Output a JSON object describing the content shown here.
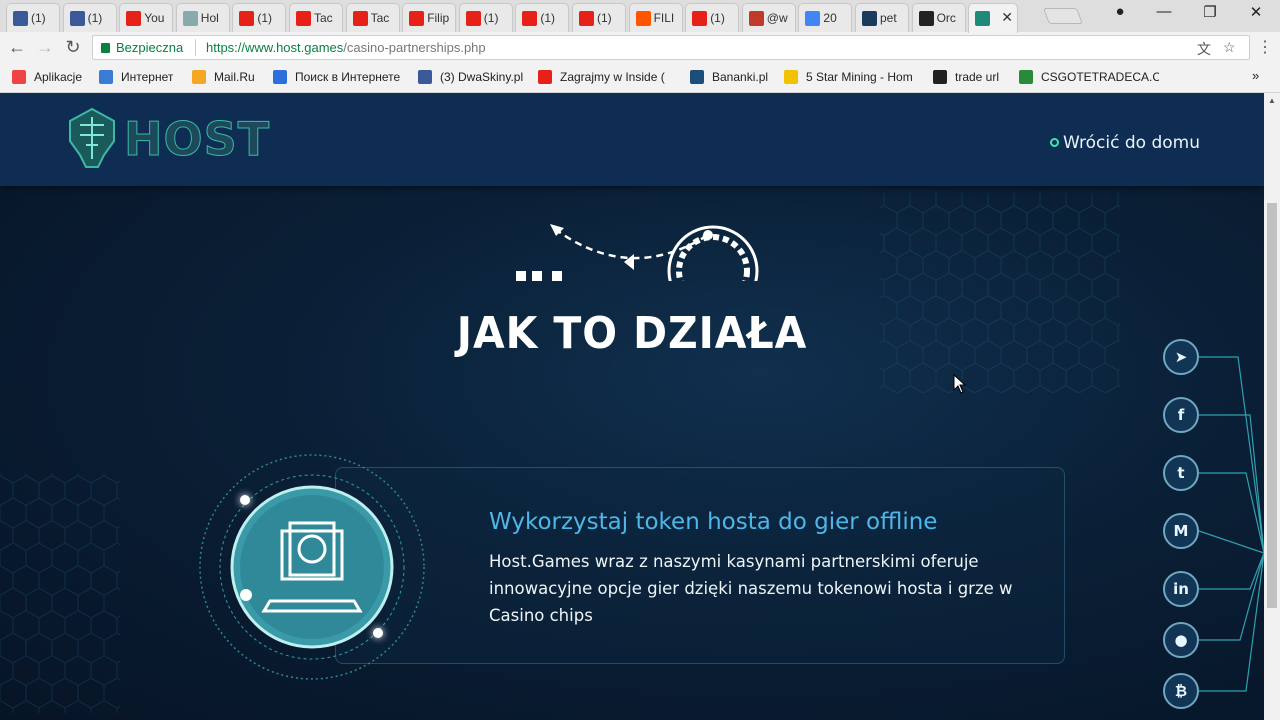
{
  "browser": {
    "tabs": [
      {
        "title": "(1)",
        "icon": "facebook-icon",
        "color": "#3b5998"
      },
      {
        "title": "(1)",
        "icon": "facebook-icon",
        "color": "#3b5998"
      },
      {
        "title": "You",
        "icon": "youtube-icon",
        "color": "#e62117"
      },
      {
        "title": "Hol",
        "icon": "diamond-icon",
        "color": "#8aa"
      },
      {
        "title": "(1)",
        "icon": "youtube-icon",
        "color": "#e62117"
      },
      {
        "title": "Tac",
        "icon": "youtube-icon",
        "color": "#e62117"
      },
      {
        "title": "Tac",
        "icon": "youtube-icon",
        "color": "#e62117"
      },
      {
        "title": "Filip",
        "icon": "youtube-icon",
        "color": "#e62117"
      },
      {
        "title": "(1)",
        "icon": "youtube-icon",
        "color": "#e62117"
      },
      {
        "title": "(1)",
        "icon": "youtube-icon",
        "color": "#e62117"
      },
      {
        "title": "(1)",
        "icon": "youtube-icon",
        "color": "#e62117"
      },
      {
        "title": "FILI",
        "icon": "soundcloud-icon",
        "color": "#f50"
      },
      {
        "title": "(1)",
        "icon": "youtube-icon",
        "color": "#e62117"
      },
      {
        "title": "@w",
        "icon": "wykop-icon",
        "color": "#c0392b"
      },
      {
        "title": "20",
        "icon": "google-icon",
        "color": "#4285f4"
      },
      {
        "title": "pet",
        "icon": "pet-icon",
        "color": "#1a3b5c"
      },
      {
        "title": "Orc",
        "icon": "steam-icon",
        "color": "#222"
      },
      {
        "title": "",
        "icon": "host-icon",
        "color": "#1f8a7a",
        "active": true
      }
    ],
    "secure_label": "Bezpieczna",
    "url_host": "https://www.host.games",
    "url_path": "/casino-partnerships.php",
    "bookmarks": [
      {
        "label": "Aplikacje",
        "icon": "apps-icon",
        "color": "#e44"
      },
      {
        "label": "Интернет",
        "icon": "globe-icon",
        "color": "#3a7bd5"
      },
      {
        "label": "Mail.Ru",
        "icon": "mailru-icon",
        "color": "#f5a623"
      },
      {
        "label": "Поиск в Интернете",
        "icon": "search-icon",
        "color": "#2a6fdb"
      },
      {
        "label": "(3) DwaSkiny.pl",
        "icon": "facebook-icon",
        "color": "#3b5998"
      },
      {
        "label": "Zagrajmy w Inside (",
        "icon": "youtube-icon",
        "color": "#e62117"
      },
      {
        "label": "Bananki.pl",
        "icon": "bananki-icon",
        "color": "#1b4e7a"
      },
      {
        "label": "5 Star Mining - Hom",
        "icon": "star-icon",
        "color": "#f2c200"
      },
      {
        "label": "trade url",
        "icon": "steam-icon",
        "color": "#222"
      },
      {
        "label": "CSGOTETRADECA.CC",
        "icon": "csgo-icon",
        "color": "#2a8a3a"
      }
    ]
  },
  "site": {
    "logo_text": "HOST",
    "home_link": "Wrócić do domu",
    "heading": "JAK TO DZIAŁA",
    "card": {
      "title": "Wykorzystaj token hosta do gier offline",
      "text": "Host.Games wraz z naszymi kasynami partnerskimi oferuje innowacyjne opcje gier dzięki naszemu tokenowi hosta i grze w Casino chips"
    },
    "social": [
      {
        "name": "telegram",
        "glyph": "➤"
      },
      {
        "name": "facebook",
        "glyph": "f"
      },
      {
        "name": "twitter",
        "glyph": "t"
      },
      {
        "name": "medium",
        "glyph": "M"
      },
      {
        "name": "linkedin",
        "glyph": "in"
      },
      {
        "name": "reddit",
        "glyph": "●"
      },
      {
        "name": "bitcoin",
        "glyph": "₿"
      }
    ],
    "colors": {
      "header": "#0f2d52",
      "accent": "#4fb6e8",
      "teal": "#3ee6b0"
    }
  }
}
